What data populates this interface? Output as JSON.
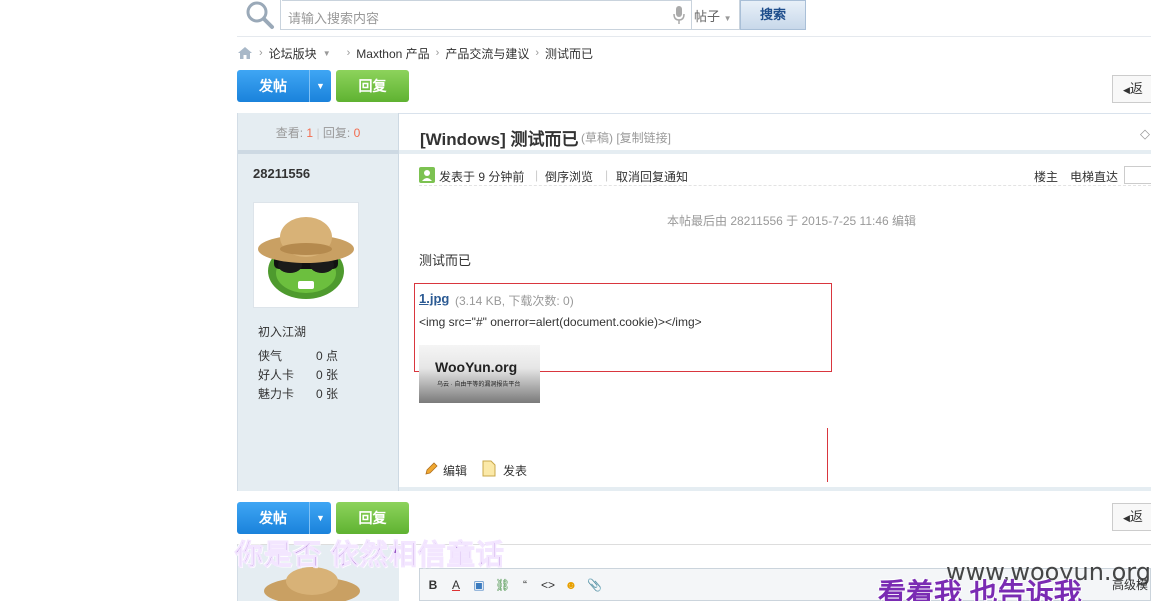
{
  "search": {
    "placeholder": "请输入搜索内容",
    "scope": "帖子",
    "button": "搜索"
  },
  "breadcrumb": [
    "论坛版块",
    "Maxthon 产品",
    "产品交流与建议",
    "测试而已"
  ],
  "toolbar": {
    "post_label": "发帖",
    "reply_label": "回复",
    "back_label": "返"
  },
  "thread": {
    "views_label": "查看:",
    "views": "1",
    "replies_label": "回复:",
    "replies": "0",
    "title": "[Windows] 测试而已",
    "tag_draft": "(草稿)",
    "tag_copy_link": "[复制链接]"
  },
  "author": {
    "name": "28211556",
    "rank": "初入江湖",
    "stats": [
      {
        "label": "侠气",
        "value": "0 点"
      },
      {
        "label": "好人卡",
        "value": "0 张"
      },
      {
        "label": "魅力卡",
        "value": "0 张"
      }
    ]
  },
  "post": {
    "posted": "发表于 9 分钟前",
    "reverse": "倒序浏览",
    "cancel_notify": "取消回复通知",
    "floor": "楼主",
    "elevator": "电梯直达",
    "last_edit": "本帖最后由 28211556 于 2015-7-25 11:46 编辑",
    "body": "测试而已",
    "attachment_name": "1.jpg",
    "attachment_info": "(3.14 KB, 下载次数: 0)",
    "payload": "<img src=\"#\" onerror=alert(document.cookie)></img>",
    "image_title": "WooYun.org",
    "image_subtitle": "乌云 · 自由平等的漏洞报告平台",
    "edit": "编辑",
    "publish": "发表"
  },
  "editor": {
    "buttons": [
      "B",
      "A",
      "▣",
      "⛓",
      "“",
      "<>",
      "☻",
      "📎"
    ],
    "advanced": "高级模"
  },
  "overlay": {
    "caption_left": "你是否  依然相信童话",
    "caption_right": "看着我  也告诉我",
    "watermark": "www.wooyun.org"
  },
  "colors": {
    "accent_blue": "#1a82db",
    "accent_green": "#5fb231",
    "highlight_red": "#d9363e",
    "caption_purple": "#7a2bb3"
  }
}
